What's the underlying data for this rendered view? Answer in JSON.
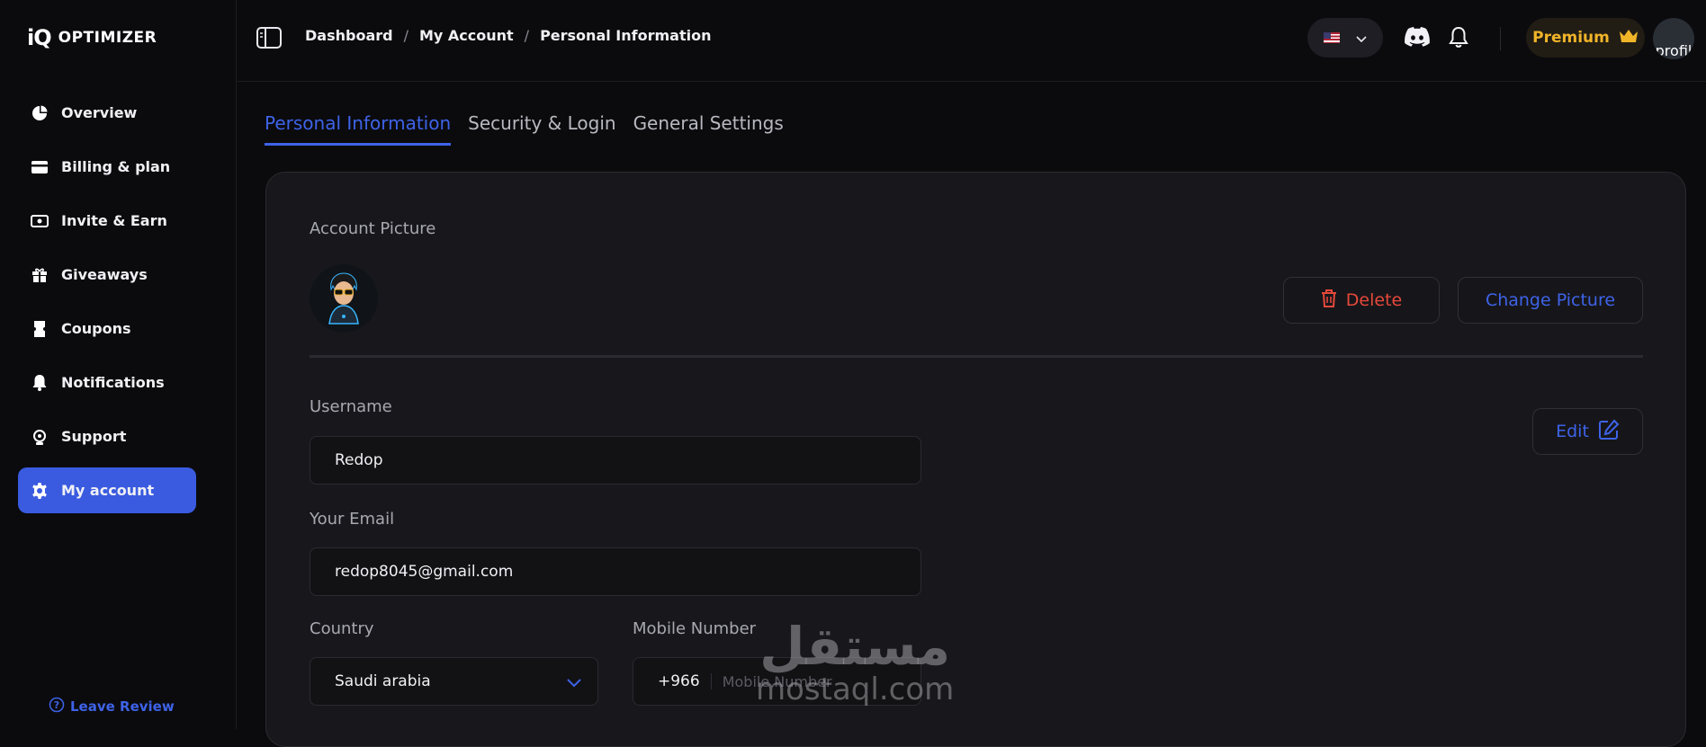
{
  "brand": {
    "mark": "iQ",
    "name": "OPTIMIZER"
  },
  "sidebar": {
    "items": [
      {
        "label": "Overview",
        "icon": "pie-chart-icon"
      },
      {
        "label": "Billing & plan",
        "icon": "credit-card-icon"
      },
      {
        "label": "Invite & Earn",
        "icon": "cash-icon"
      },
      {
        "label": "Giveaways",
        "icon": "gift-icon"
      },
      {
        "label": "Coupons",
        "icon": "coupon-icon"
      },
      {
        "label": "Notifications",
        "icon": "bell-icon"
      },
      {
        "label": "Support",
        "icon": "headset-icon"
      },
      {
        "label": "My account",
        "icon": "gear-icon",
        "active": true
      }
    ],
    "leave_review": "Leave Review"
  },
  "topbar": {
    "breadcrumb": [
      "Dashboard",
      "My Account",
      "Personal Information"
    ],
    "language_flag": "us-flag-icon",
    "premium_label": "Premium",
    "avatar_alt": "profil"
  },
  "tabs": [
    {
      "label": "Personal Information",
      "active": true
    },
    {
      "label": "Security & Login"
    },
    {
      "label": "General Settings"
    }
  ],
  "profile": {
    "account_picture_label": "Account Picture",
    "delete_label": "Delete",
    "change_picture_label": "Change Picture",
    "edit_label": "Edit",
    "username_label": "Username",
    "username_value": "Redop",
    "email_label": "Your Email",
    "email_value": "redop8045@gmail.com",
    "country_label": "Country",
    "country_value": "Saudi arabia",
    "mobile_label": "Mobile Number",
    "mobile_code": "+966",
    "mobile_placeholder": "Mobile Number"
  },
  "watermark": {
    "arabic": "مستقل",
    "latin": "mostaql.com"
  },
  "colors": {
    "accent": "#3e63e8",
    "danger": "#e5483a",
    "premium": "#f0b429",
    "background": "#0b0b0e",
    "card": "#18181c"
  }
}
